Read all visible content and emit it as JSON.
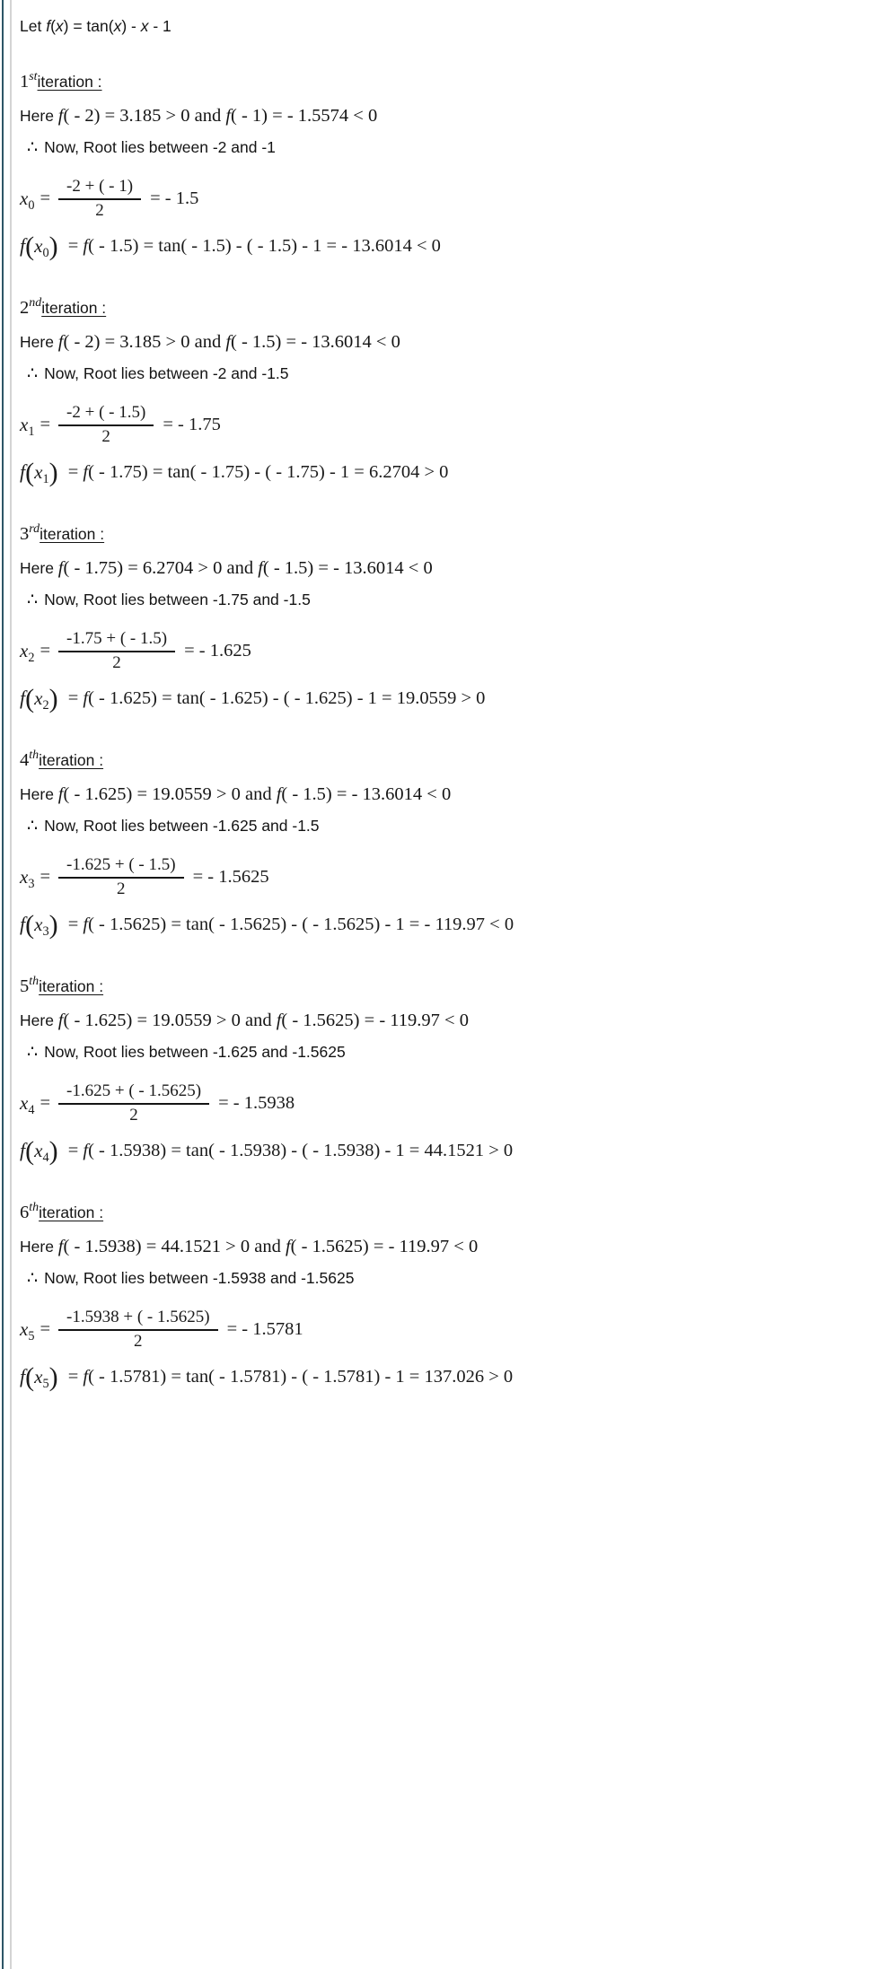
{
  "document": {
    "intro": {
      "lead": "Let ",
      "f_var": "f",
      "expr": "(x) = tan(x) - x - 1"
    },
    "accent_color": "#2d5566",
    "rule_color": "#d4d4d4",
    "iterations": [
      {
        "ordinal_number": "1",
        "ordinal_suffix": "st",
        "heading_label": "iteration :",
        "here_prefix": "Here ",
        "here_f1_arg": "( - 2) = 3.185 > 0 and ",
        "here_f2_arg": "( - 1) =  - 1.5574 < 0",
        "therefore_symbol": "∴",
        "therefore_text": "Now, Root lies between -2 and -1",
        "x_label": "x",
        "x_subscript": "0",
        "numerator": "-2 + ( - 1)",
        "denominator": "2",
        "result": "=  - 1.5",
        "feval_result": " = f( - 1.5) = tan( - 1.5) - ( - 1.5) - 1 =  - 13.6014 < 0"
      },
      {
        "ordinal_number": "2",
        "ordinal_suffix": "nd",
        "heading_label": "iteration :",
        "here_prefix": "Here ",
        "here_f1_arg": "( - 2) = 3.185 > 0 and ",
        "here_f2_arg": "( - 1.5) =  - 13.6014 < 0",
        "therefore_symbol": "∴",
        "therefore_text": "Now, Root lies between -2 and -1.5",
        "x_label": "x",
        "x_subscript": "1",
        "numerator": "-2 + ( - 1.5)",
        "denominator": "2",
        "result": "=  - 1.75",
        "feval_result": " = f( - 1.75) = tan( - 1.75) - ( - 1.75) - 1 = 6.2704 > 0"
      },
      {
        "ordinal_number": "3",
        "ordinal_suffix": "rd",
        "heading_label": "iteration :",
        "here_prefix": "Here ",
        "here_f1_arg": "( - 1.75) = 6.2704 > 0 and ",
        "here_f2_arg": "( - 1.5) =  - 13.6014 < 0",
        "therefore_symbol": "∴",
        "therefore_text": "Now, Root lies between -1.75 and -1.5",
        "x_label": "x",
        "x_subscript": "2",
        "numerator": "-1.75 + ( - 1.5)",
        "denominator": "2",
        "result": "=  - 1.625",
        "feval_result": " = f( - 1.625) = tan( - 1.625) - ( - 1.625) - 1 = 19.0559 > 0"
      },
      {
        "ordinal_number": "4",
        "ordinal_suffix": "th",
        "heading_label": "iteration :",
        "here_prefix": "Here ",
        "here_f1_arg": "( - 1.625) = 19.0559 > 0 and ",
        "here_f2_arg": "( - 1.5) =  - 13.6014 < 0",
        "therefore_symbol": "∴",
        "therefore_text": "Now, Root lies between -1.625 and -1.5",
        "x_label": "x",
        "x_subscript": "3",
        "numerator": "-1.625 + ( - 1.5)",
        "denominator": "2",
        "result": "=  - 1.5625",
        "feval_result": " = f( - 1.5625) = tan( - 1.5625) - ( - 1.5625) - 1 =  - 119.97 < 0"
      },
      {
        "ordinal_number": "5",
        "ordinal_suffix": "th",
        "heading_label": "iteration :",
        "here_prefix": "Here ",
        "here_f1_arg": "( - 1.625) = 19.0559 > 0 and ",
        "here_f2_arg": "( - 1.5625) =  - 119.97 < 0",
        "therefore_symbol": "∴",
        "therefore_text": "Now, Root lies between -1.625 and -1.5625",
        "x_label": "x",
        "x_subscript": "4",
        "numerator": "-1.625 + ( - 1.5625)",
        "denominator": "2",
        "result": "=  - 1.5938",
        "feval_result": " = f( - 1.5938) = tan( - 1.5938) - ( - 1.5938) - 1 = 44.1521 > 0"
      },
      {
        "ordinal_number": "6",
        "ordinal_suffix": "th",
        "heading_label": "iteration :",
        "here_prefix": "Here ",
        "here_f1_arg": "( - 1.5938) = 44.1521 > 0 and ",
        "here_f2_arg": "( - 1.5625) =  - 119.97 < 0",
        "therefore_symbol": "∴",
        "therefore_text": "Now, Root lies between -1.5938 and -1.5625",
        "x_label": "x",
        "x_subscript": "5",
        "numerator": "-1.5938 + ( - 1.5625)",
        "denominator": "2",
        "result": "=  - 1.5781",
        "feval_result": " = f( - 1.5781) = tan( - 1.5781) - ( - 1.5781) - 1 = 137.026 > 0"
      }
    ]
  }
}
